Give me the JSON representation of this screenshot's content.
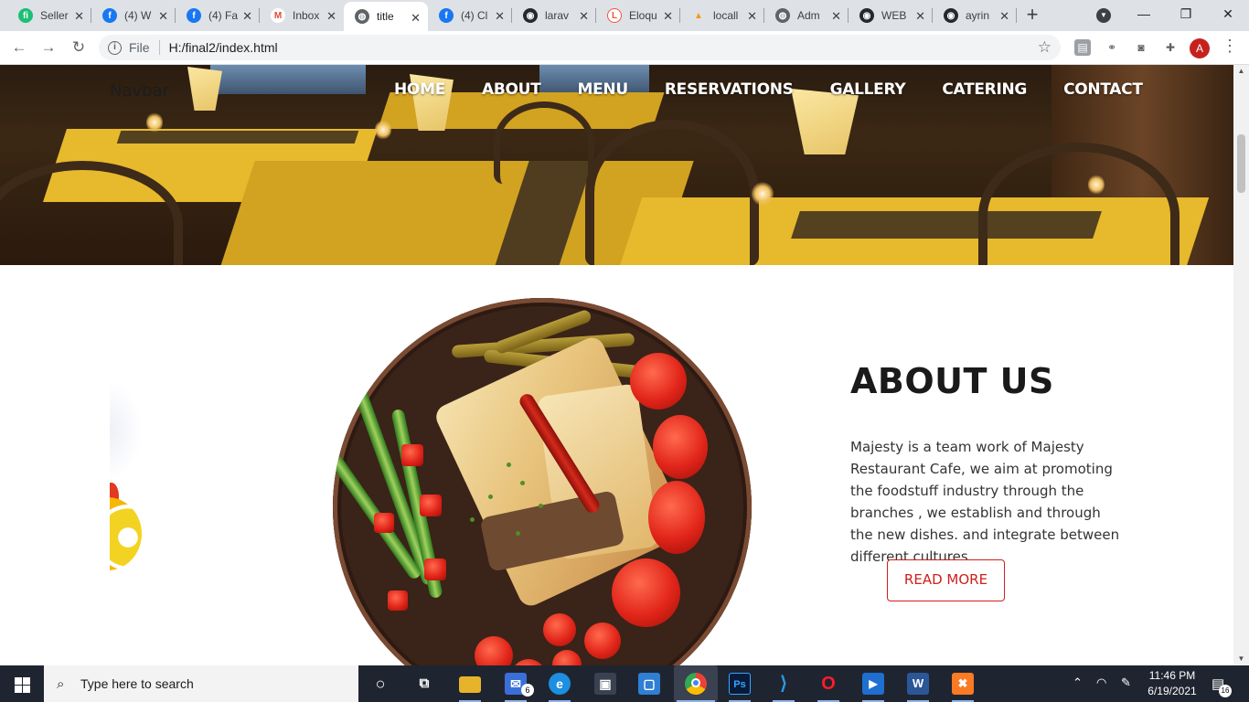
{
  "browser": {
    "tabs": [
      {
        "title": "Seller",
        "icon": "fiverr-icon",
        "color": "#1dbf73",
        "glyph": "fi"
      },
      {
        "title": "(4) W",
        "icon": "facebook-icon",
        "color": "#1877f2",
        "glyph": "f"
      },
      {
        "title": "(4) Fa",
        "icon": "facebook-icon",
        "color": "#1877f2",
        "glyph": "f"
      },
      {
        "title": "Inbox",
        "icon": "gmail-icon",
        "color": "#ea4335",
        "glyph": "M"
      },
      {
        "title": "title",
        "icon": "globe-icon",
        "color": "#5f6368",
        "glyph": "◍"
      },
      {
        "title": "(4) Cl",
        "icon": "facebook-icon",
        "color": "#1877f2",
        "glyph": "f"
      },
      {
        "title": "larav",
        "icon": "github-icon",
        "color": "#24292e",
        "glyph": "◉"
      },
      {
        "title": "Eloqu",
        "icon": "laravel-icon",
        "color": "#f05340",
        "glyph": "L"
      },
      {
        "title": "locall",
        "icon": "phpmyadmin-icon",
        "color": "#f39c12",
        "glyph": "▲"
      },
      {
        "title": "Adm",
        "icon": "globe-icon",
        "color": "#5f6368",
        "glyph": "◍"
      },
      {
        "title": "WEB",
        "icon": "github-icon",
        "color": "#24292e",
        "glyph": "◉"
      },
      {
        "title": "ayrin",
        "icon": "github-icon",
        "color": "#24292e",
        "glyph": "◉"
      }
    ],
    "active_tab_index": 4,
    "new_tab": "+",
    "address": {
      "scheme_label": "File",
      "url": "H:/final2/index.html"
    },
    "profile_initial": "A"
  },
  "page": {
    "brand": "Navbar",
    "nav": [
      "HOME",
      "ABOUT",
      "MENU",
      "RESERVATIONS",
      "GALLERY",
      "CATERING",
      "CONTACT"
    ],
    "about": {
      "title": "ABOUT US",
      "text": "Majesty is a team work of Majesty Restaurant Cafe, we aim at promoting the foodstuff industry through the branches , we establish and through the new dishes. and integrate between different cultures.",
      "button": "READ MORE"
    },
    "accent_color": "#d0201c"
  },
  "taskbar": {
    "search_placeholder": "Type here to search",
    "apps": [
      {
        "name": "cortana-icon",
        "glyph": "○"
      },
      {
        "name": "task-view-icon",
        "glyph": "⧉"
      },
      {
        "name": "file-explorer-icon",
        "glyph": "▬"
      },
      {
        "name": "mail-icon",
        "glyph": "✉",
        "badge": "6"
      },
      {
        "name": "edge-icon",
        "glyph": "e"
      },
      {
        "name": "store-icon",
        "glyph": "▣"
      },
      {
        "name": "remote-app-icon",
        "glyph": "▢"
      },
      {
        "name": "chrome-icon",
        "glyph": "●"
      },
      {
        "name": "photoshop-icon",
        "glyph": "Ps"
      },
      {
        "name": "vscode-icon",
        "glyph": "⟩"
      },
      {
        "name": "opera-icon",
        "glyph": "O"
      },
      {
        "name": "media-player-icon",
        "glyph": "▶"
      },
      {
        "name": "word-icon",
        "glyph": "W"
      },
      {
        "name": "xampp-icon",
        "glyph": "✖"
      }
    ],
    "time": "11:46 PM",
    "date": "6/19/2021",
    "notification_count": "16"
  }
}
